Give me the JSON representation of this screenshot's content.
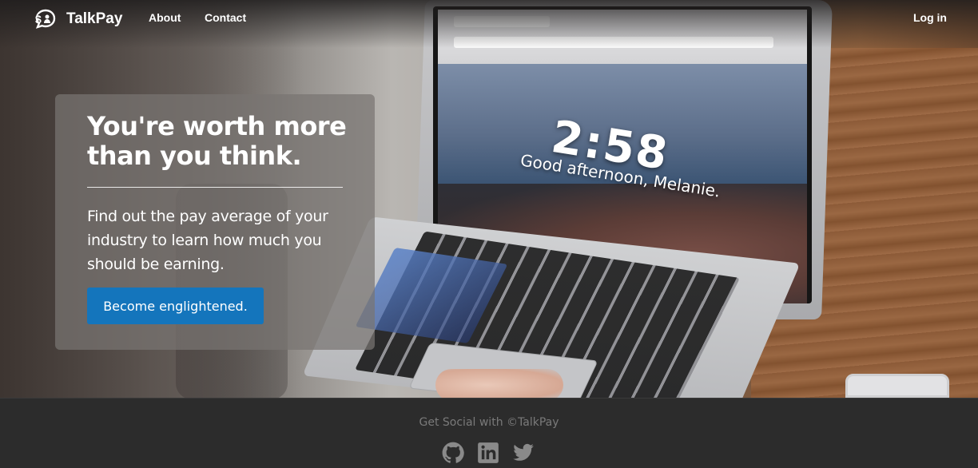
{
  "nav": {
    "brand": "TalkPay",
    "brand_icon": "money-chat-icon",
    "links": [
      {
        "label": "About"
      },
      {
        "label": "Contact"
      }
    ],
    "login_label": "Log in"
  },
  "hero": {
    "title": "You're worth more than you think.",
    "subtitle": "Find out the pay average of your industry to learn how much you should be earning.",
    "cta_label": "Become englightened.",
    "background": {
      "clock": "2:58",
      "greeting": "Good afternoon, Melanie."
    }
  },
  "footer": {
    "text": "Get Social with ©TalkPay",
    "social": [
      {
        "icon": "github-icon"
      },
      {
        "icon": "linkedin-icon"
      },
      {
        "icon": "twitter-icon"
      }
    ]
  },
  "colors": {
    "accent": "#1475bc",
    "footer_bg": "#2c2c2c",
    "footer_text": "#7a7a7a",
    "card_bg": "rgba(120,116,114,0.72)"
  }
}
